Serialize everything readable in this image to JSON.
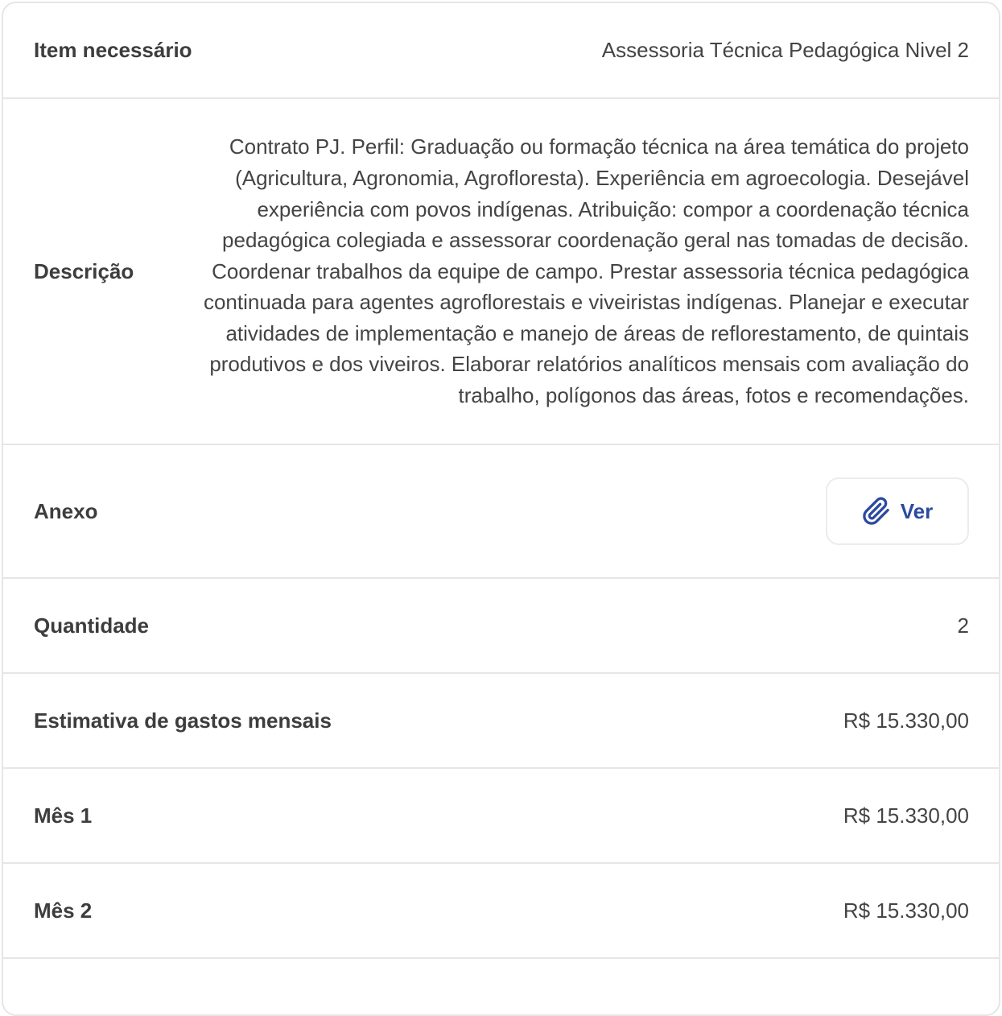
{
  "rows": {
    "item": {
      "label": "Item necessário",
      "value": "Assessoria Técnica Pedagógica Nivel 2"
    },
    "descricao": {
      "label": "Descrição",
      "value": "Contrato PJ. Perfil: Graduação ou formação técnica na área temática do projeto (Agricultura, Agronomia, Agrofloresta). Experiência em agroecologia. Desejável experiência com povos indígenas. Atribuição: compor a coordenação técnica pedagógica colegiada e assessorar coordenação geral nas tomadas de decisão. Coordenar trabalhos da equipe de campo. Prestar assessoria técnica pedagógica continuada para agentes agroflorestais e viveiristas indígenas. Planejar e executar atividades de implementação e manejo de áreas de reflorestamento, de quintais produtivos e dos viveiros. Elaborar relatórios analíticos mensais com avaliação do trabalho, polígonos das áreas, fotos e recomendações."
    },
    "anexo": {
      "label": "Anexo",
      "button_label": "Ver",
      "button_icon": "paperclip-icon"
    },
    "quantidade": {
      "label": "Quantidade",
      "value": "2"
    },
    "estimativa": {
      "label": "Estimativa de gastos mensais",
      "value": "R$ 15.330,00"
    },
    "mes1": {
      "label": "Mês 1",
      "value": "R$ 15.330,00"
    },
    "mes2": {
      "label": "Mês 2",
      "value": "R$ 15.330,00"
    }
  },
  "colors": {
    "accent": "#2c4aa0",
    "border": "#e6e6e6",
    "text": "#444444"
  }
}
